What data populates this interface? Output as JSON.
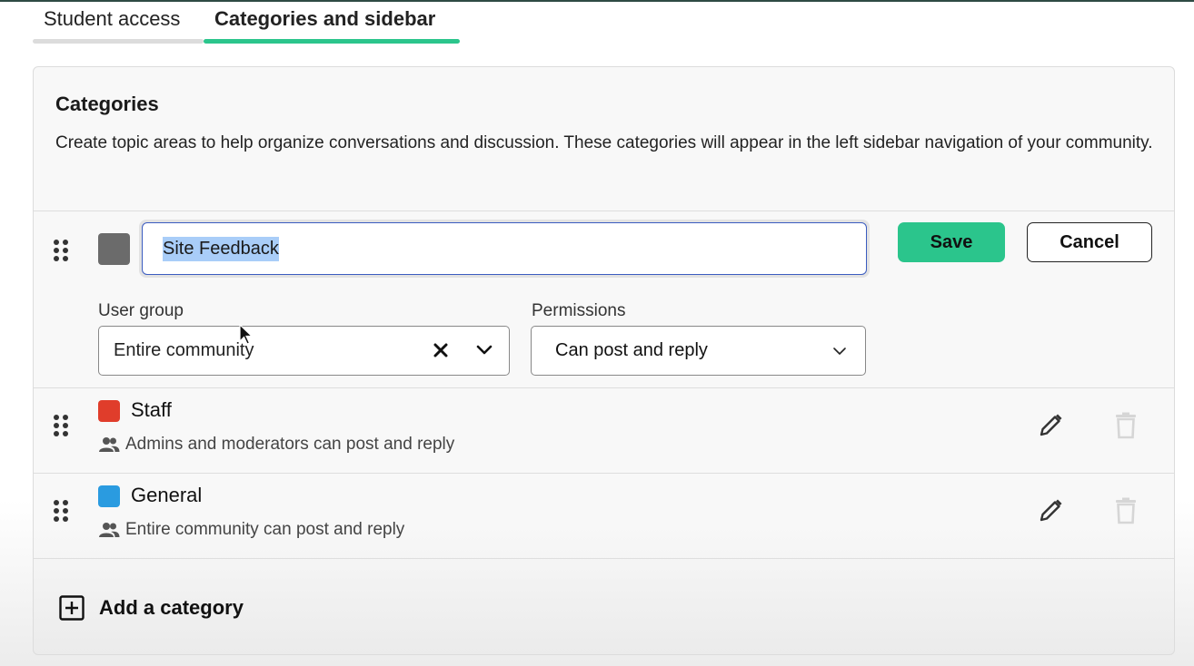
{
  "tabs": [
    {
      "label": "Student access",
      "active": false
    },
    {
      "label": "Categories and sidebar",
      "active": true
    }
  ],
  "section": {
    "title": "Categories",
    "description": "Create topic areas to help organize conversations and discussion. These categories will appear in the left sidebar navigation of your community."
  },
  "editor": {
    "color": "#6b6b6b",
    "name_value": "Site Feedback",
    "save_label": "Save",
    "cancel_label": "Cancel",
    "user_group_label": "User group",
    "user_group_value": "Entire community",
    "permissions_label": "Permissions",
    "permissions_value": "Can post and reply"
  },
  "categories": [
    {
      "name": "Staff",
      "color": "#e03d2b",
      "description": "Admins and moderators can post and reply",
      "edit_icon": "pencil-icon",
      "delete_icon": "trash-icon"
    },
    {
      "name": "General",
      "color": "#2a9be0",
      "description": "Entire community can post and reply",
      "edit_icon": "pencil-icon",
      "delete_icon": "trash-icon"
    }
  ],
  "add_category_label": "Add a category",
  "colors": {
    "accent": "#2bc58c",
    "input_focus": "#3b5cc0",
    "selection": "#a9cdf8",
    "trash_disabled": "#d6d6d6"
  }
}
